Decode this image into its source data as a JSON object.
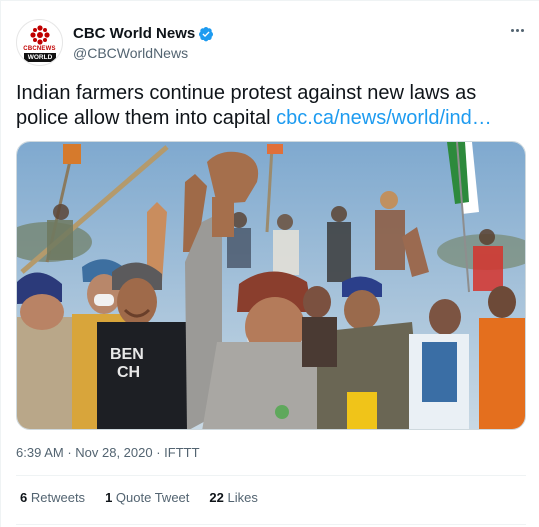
{
  "account": {
    "display_name": "CBC World News",
    "handle": "@CBCWorldNews",
    "avatar_text_top": "CBCNEWS",
    "avatar_text_bottom": "WORLD",
    "verified_icon": "verified-badge-icon"
  },
  "tweet": {
    "text": "Indian farmers continue protest against new laws as police allow them into capital ",
    "link": "cbc.ca/news/world/ind…"
  },
  "meta": {
    "time": "6:39 AM",
    "sep1": " · ",
    "date": "Nov 28, 2020",
    "sep2": " · ",
    "source": "IFTTT"
  },
  "stats": {
    "retweets_count": "6",
    "retweets_label": "Retweets",
    "quotes_count": "1",
    "quotes_label": "Quote Tweet",
    "likes_count": "22",
    "likes_label": "Likes"
  },
  "photo": {
    "shirt_text": "BEN\nCH"
  },
  "colors": {
    "link": "#1d9bf0",
    "verified": "#1d9bf0",
    "text": "#0f1419",
    "muted": "#536471",
    "cbc_red": "#c00000"
  }
}
